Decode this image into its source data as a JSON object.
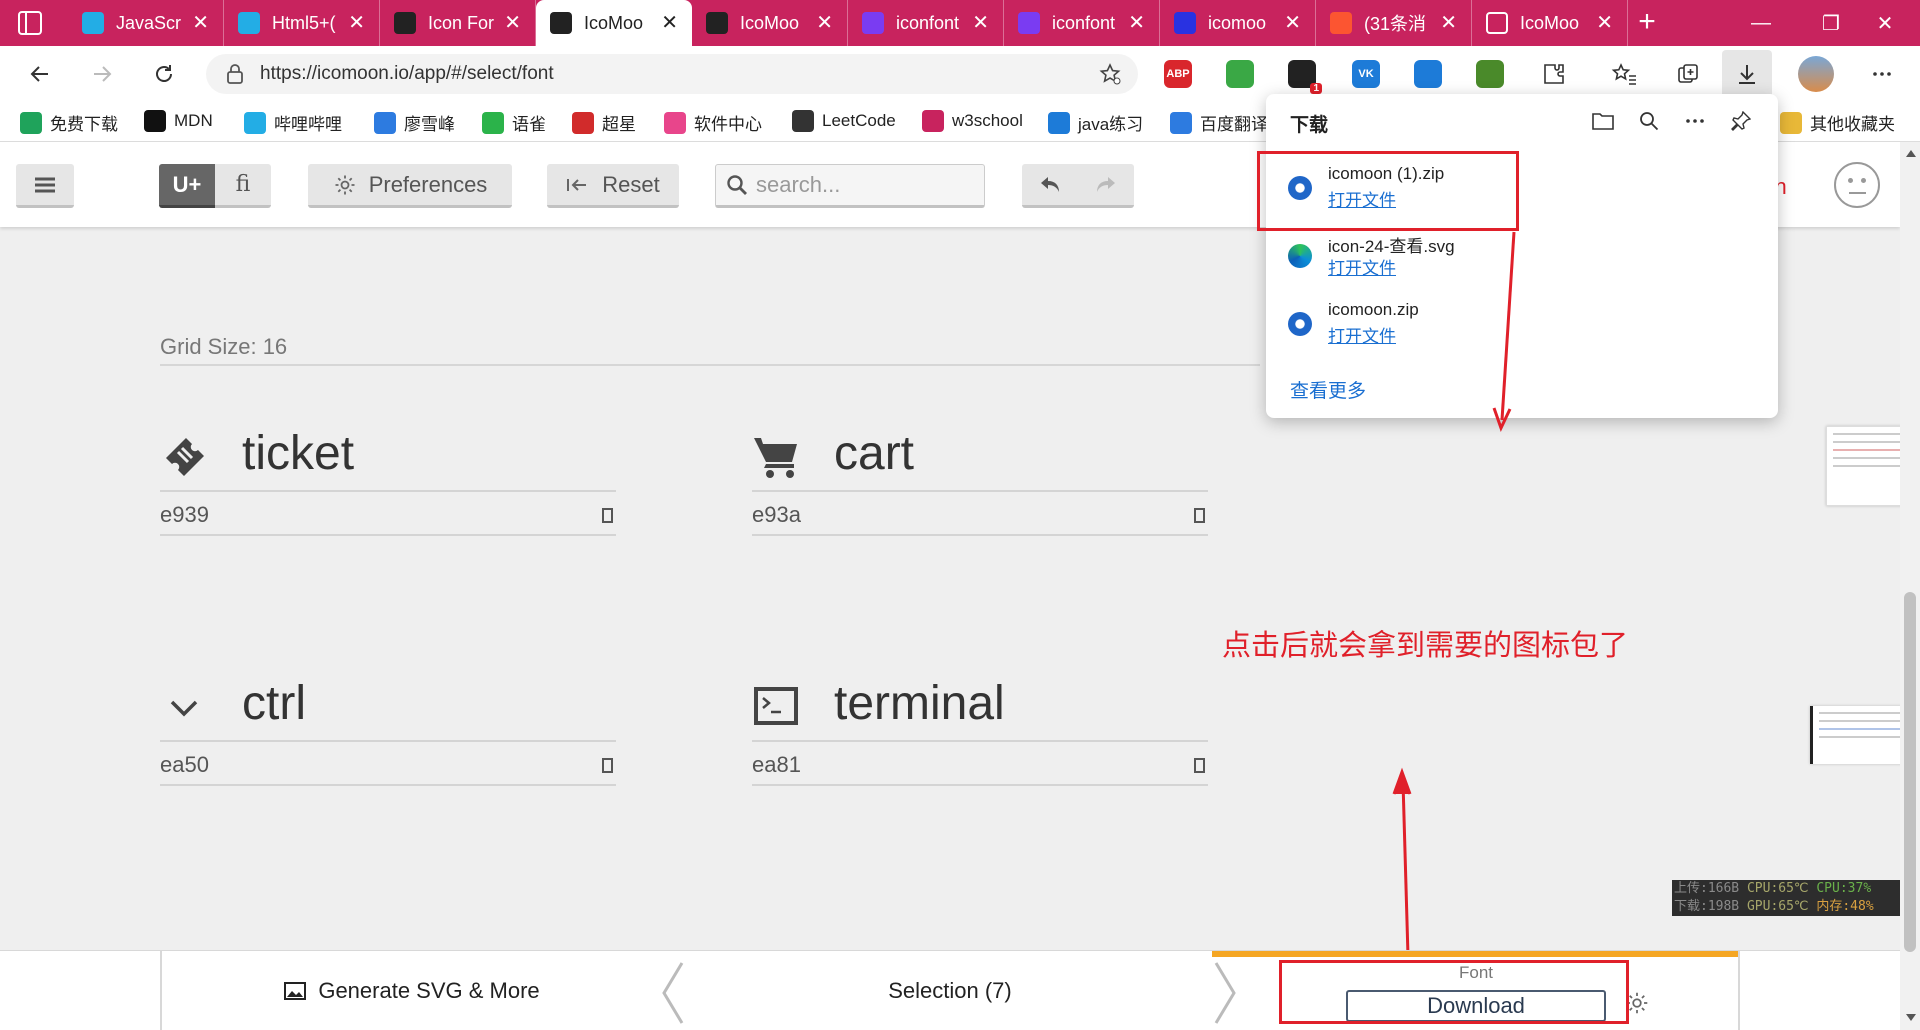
{
  "browser": {
    "tabs": [
      {
        "title": "JavaScri",
        "favicon": "bilibili-icon",
        "color": "#23ade5"
      },
      {
        "title": "Html5+(",
        "favicon": "bilibili-icon",
        "color": "#23ade5"
      },
      {
        "title": "Icon For",
        "favicon": "icomoon-icon",
        "color": "#222222"
      },
      {
        "title": "IcoMoo",
        "favicon": "icomoon-icon",
        "color": "#222222",
        "active": true
      },
      {
        "title": "IcoMoo",
        "favicon": "icomoon-icon",
        "color": "#222222"
      },
      {
        "title": "iconfont",
        "favicon": "iconfont-icon",
        "color": "#7a3cf2"
      },
      {
        "title": "iconfont",
        "favicon": "iconfont-icon",
        "color": "#7a3cf2"
      },
      {
        "title": "icomoo",
        "favicon": "baidu-icon",
        "color": "#2932e1"
      },
      {
        "title": "(31条消",
        "favicon": "csdn-icon",
        "color": "#fc5531"
      },
      {
        "title": "IcoMoo",
        "favicon": "page-icon",
        "color": "#ffffff"
      }
    ],
    "url": "https://icomoon.io/app/#/select/font",
    "extensions": [
      {
        "name": "adblock-icon",
        "label": "ABP",
        "color": "#d9262c"
      },
      {
        "name": "shield-icon",
        "label": "",
        "color": "#3aa845"
      },
      {
        "name": "notification-icon",
        "label": "1",
        "color": "#222222"
      },
      {
        "name": "vk-icon",
        "label": "VK",
        "color": "#1d7bd8"
      },
      {
        "name": "sync-icon",
        "label": "",
        "color": "#1d7bd8"
      },
      {
        "name": "globe-icon",
        "label": "",
        "color": "#4a8a2a"
      }
    ],
    "bookmarks": [
      {
        "label": "免费下载",
        "color": "#1fa35b"
      },
      {
        "label": "MDN",
        "color": "#111111"
      },
      {
        "label": "哔哩哔哩",
        "color": "#23ade5"
      },
      {
        "label": "廖雪峰",
        "color": "#2d7be0"
      },
      {
        "label": "语雀",
        "color": "#2bb34a"
      },
      {
        "label": "超星",
        "color": "#d12b2b"
      },
      {
        "label": "软件中心",
        "color": "#e8458b"
      },
      {
        "label": "LeetCode",
        "color": "#333333"
      },
      {
        "label": "w3school",
        "color": "#c8235e"
      },
      {
        "label": "java练习",
        "color": "#1d7bd8"
      },
      {
        "label": "百度翻译",
        "color": "#2d7be0"
      },
      {
        "label": "其他收藏夹",
        "color": "#e8b838"
      }
    ]
  },
  "toolbar": {
    "unicode_label": "U+",
    "ligature_label": "fi",
    "preferences_label": "Preferences",
    "reset_label": "Reset",
    "search_placeholder": "search...",
    "signin_label": "n In"
  },
  "main": {
    "grid_size_label": "Grid Size: 16",
    "glyphs": [
      {
        "name": "ticket",
        "code": "e939",
        "icon": "ticket-icon"
      },
      {
        "name": "cart",
        "code": "e93a",
        "icon": "cart-icon"
      },
      {
        "name": "ctrl",
        "code": "ea50",
        "icon": "ctrl-icon"
      },
      {
        "name": "terminal",
        "code": "ea81",
        "icon": "terminal-icon"
      }
    ]
  },
  "downloads": {
    "title": "下载",
    "items": [
      {
        "name": "icomoon (1).zip",
        "action": "打开文件",
        "icon": "zip-icon"
      },
      {
        "name": "icon-24-查看.svg",
        "action": "打开文件",
        "icon": "edge-icon"
      },
      {
        "name": "icomoon.zip",
        "action": "打开文件",
        "icon": "zip-icon"
      }
    ],
    "see_more": "查看更多"
  },
  "annotation": "点击后就会拿到需要的图标包了",
  "bottombar": {
    "generate_label": "Generate SVG & More",
    "selection_label": "Selection (7)",
    "font_label": "Font",
    "download_label": "Download"
  },
  "netmon": {
    "line1_a": "上传:166B",
    "line1_b": "CPU:65℃",
    "line1_c": "CPU:37%",
    "line2_a": "下载:198B",
    "line2_b": "GPU:65℃",
    "line2_c": "内存:48%"
  },
  "colors": {
    "tabstrip": "#c8235e",
    "annotation": "#e0202a",
    "link": "#1a6fd1",
    "progress": "#f5a623"
  }
}
